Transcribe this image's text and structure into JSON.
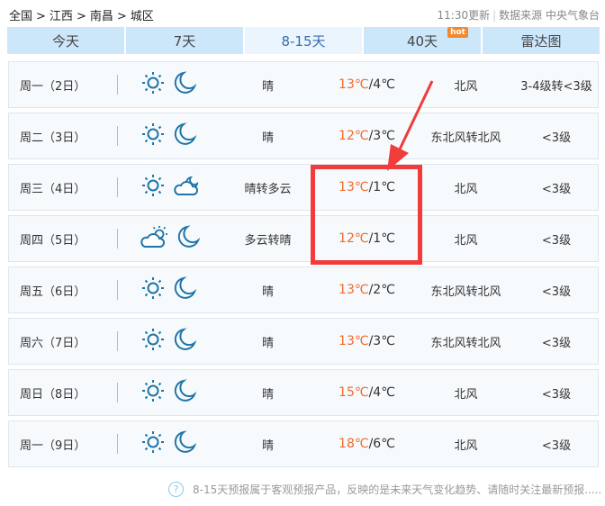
{
  "breadcrumb": [
    "全国",
    ">",
    "江西",
    ">",
    "南昌",
    ">",
    "城区"
  ],
  "source": {
    "updated": "11:30更新",
    "label": "数据来源 中央气象台"
  },
  "tabs": [
    {
      "label": "今天"
    },
    {
      "label": "7天"
    },
    {
      "label": "8-15天",
      "active": true
    },
    {
      "label": "40天",
      "badge": "hot"
    },
    {
      "label": "雷达图"
    }
  ],
  "rows": [
    {
      "date": "周一（2日）",
      "icons": [
        "sun",
        "moon"
      ],
      "weather": "晴",
      "high": "13℃",
      "low": "/4℃",
      "wind": "北风",
      "level": "3-4级转<3级"
    },
    {
      "date": "周二（3日）",
      "icons": [
        "sun",
        "moon"
      ],
      "weather": "晴",
      "high": "12℃",
      "low": "/3℃",
      "wind": "东北风转北风",
      "level": "<3级"
    },
    {
      "date": "周三（4日）",
      "icons": [
        "sun",
        "cloud-moon"
      ],
      "weather": "晴转多云",
      "high": "13℃",
      "low": "/1℃",
      "wind": "北风",
      "level": "<3级"
    },
    {
      "date": "周四（5日）",
      "icons": [
        "cloud-sun",
        "moon"
      ],
      "weather": "多云转晴",
      "high": "12℃",
      "low": "/1℃",
      "wind": "北风",
      "level": "<3级"
    },
    {
      "date": "周五（6日）",
      "icons": [
        "sun",
        "moon"
      ],
      "weather": "晴",
      "high": "13℃",
      "low": "/2℃",
      "wind": "东北风转北风",
      "level": "<3级"
    },
    {
      "date": "周六（7日）",
      "icons": [
        "sun",
        "moon"
      ],
      "weather": "晴",
      "high": "13℃",
      "low": "/3℃",
      "wind": "东北风转北风",
      "level": "<3级"
    },
    {
      "date": "周日（8日）",
      "icons": [
        "sun",
        "moon"
      ],
      "weather": "晴",
      "high": "15℃",
      "low": "/4℃",
      "wind": "北风",
      "level": "<3级"
    },
    {
      "date": "周一（9日）",
      "icons": [
        "sun",
        "moon"
      ],
      "weather": "晴",
      "high": "18℃",
      "low": "/6℃",
      "wind": "北风",
      "level": "<3级"
    }
  ],
  "footer": {
    "icon": "?",
    "text": "8-15天预报属于客观预报产品，反映的是未来天气变化趋势、请随时关注最新预报....."
  },
  "colors": {
    "high": "#f26a2c",
    "icon": "#1f74a8",
    "annotation": "#f23b3b"
  }
}
